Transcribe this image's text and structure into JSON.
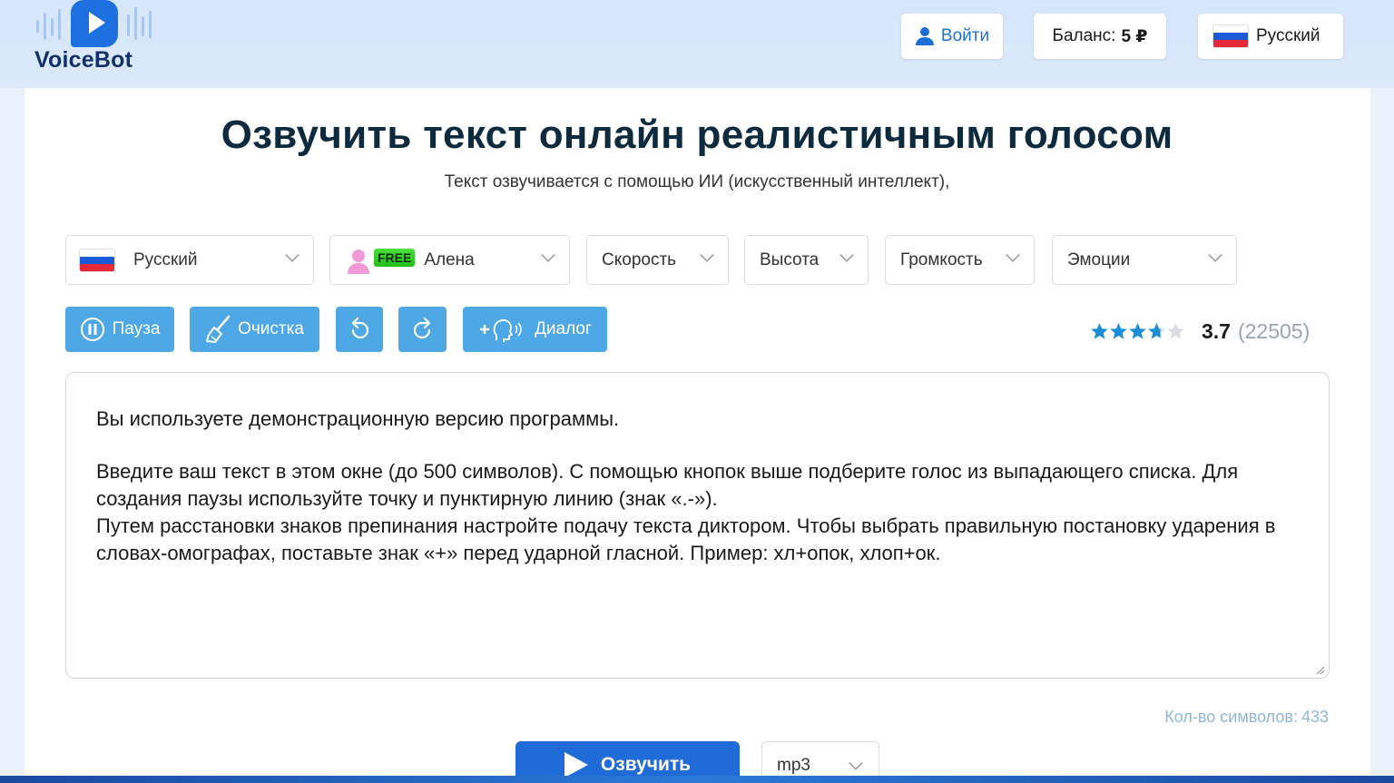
{
  "header": {
    "logo_text": "VoiceBot",
    "login_label": "Войти",
    "balance_label": "Баланс:",
    "balance_value": "5 ₽",
    "language_label": "Русский"
  },
  "main": {
    "title": "Озвучить текст онлайн реалистичным голосом",
    "subtitle": "Текст озвучивается с помощью ИИ (искусственный интеллект),"
  },
  "controls": {
    "language": "Русский",
    "voice_badge": "FREE",
    "voice": "Алена",
    "speed": "Скорость",
    "pitch": "Высота",
    "volume": "Громкость",
    "emotion": "Эмоции"
  },
  "toolbar": {
    "pause": "Пауза",
    "clear": "Очистка",
    "dialog": "Диалог"
  },
  "rating": {
    "value": "3.7",
    "count": "(22505)",
    "stars_filled": 3.7,
    "stars_total": 5
  },
  "editor": {
    "line1": "Вы используете демонстрационную версию программы.",
    "line2": "Введите ваш текст в этом окне (до 500 символов). С помощью кнопок выше подберите голос из выпадающего списка. Для создания паузы используйте точку и пунктирную линию (знак «.-»).",
    "line3": "Путем расстановки знаков препинания настройте подачу текста диктором. Чтобы выбрать правильную постановку ударения в словах-омографах, поставьте знак «+» перед ударной гласной. Пример: хл+опок, хлоп+ок."
  },
  "footer": {
    "char_count_label": "Кол-во символов:",
    "char_count_value": "433",
    "synth_label": "Озвучить",
    "format": "mp3"
  },
  "colors": {
    "accent": "#4fa8e6",
    "primary": "#1f6bd7",
    "title": "#0e2a3f",
    "star": "#1a8fd8"
  }
}
